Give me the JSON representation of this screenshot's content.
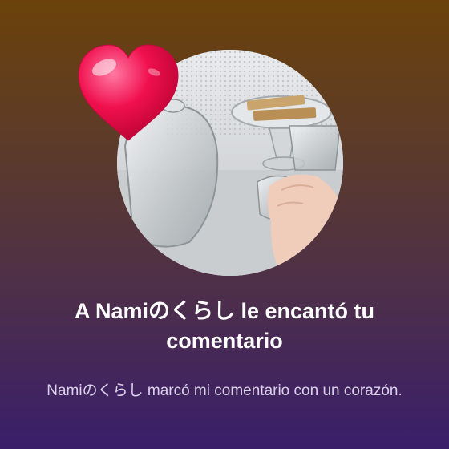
{
  "notification": {
    "title": "A Namiのくらし le encantó tu comentario",
    "subtitle": "Namiのくらし marcó mi comentario con un corazón."
  },
  "icons": {
    "reaction": "heart-icon"
  },
  "colors": {
    "background_top": "#6b420a",
    "background_bottom": "#3a1e6b",
    "heart": "#f0104e",
    "title_text": "#ffffff",
    "subtitle_text": "#d9d2e8"
  }
}
